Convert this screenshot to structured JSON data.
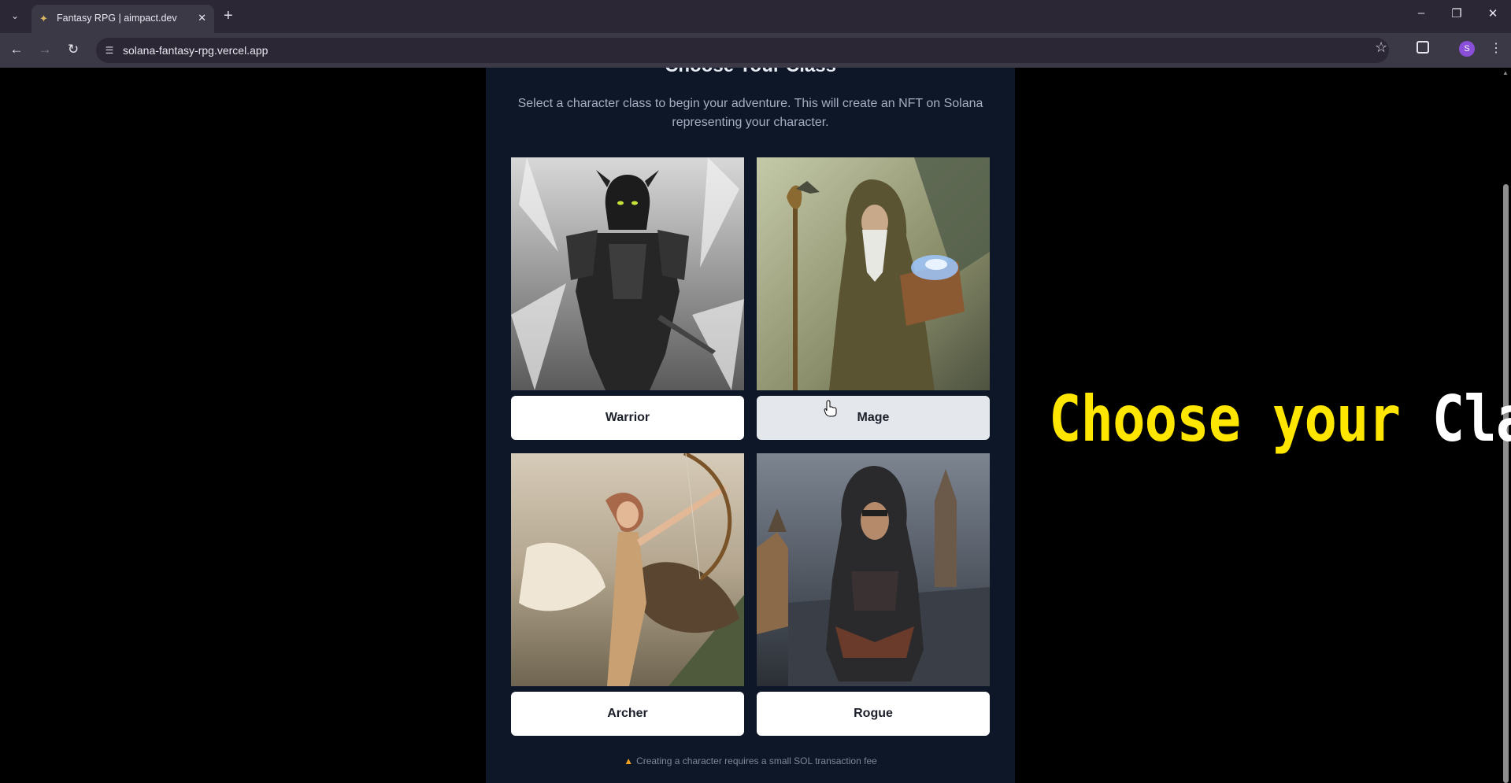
{
  "browser": {
    "tab_title": "Fantasy RPG | aimpact.dev",
    "url": "solana-fantasy-rpg.vercel.app",
    "avatar_initial": "S"
  },
  "page": {
    "section_title": "Choose Your Class",
    "intro": "Select a character class to begin your adventure. This will create an NFT on Solana representing your character.",
    "classes": [
      {
        "name": "Warrior"
      },
      {
        "name": "Mage"
      },
      {
        "name": "Archer"
      },
      {
        "name": "Rogue"
      }
    ],
    "fee_note": "Creating a character requires a small SOL transaction fee"
  },
  "overlay": {
    "title_part1": "Choose your",
    "title_part2": "Class"
  },
  "colors": {
    "panel_bg": "#0e1727",
    "overlay_yellow": "#ffe600"
  }
}
